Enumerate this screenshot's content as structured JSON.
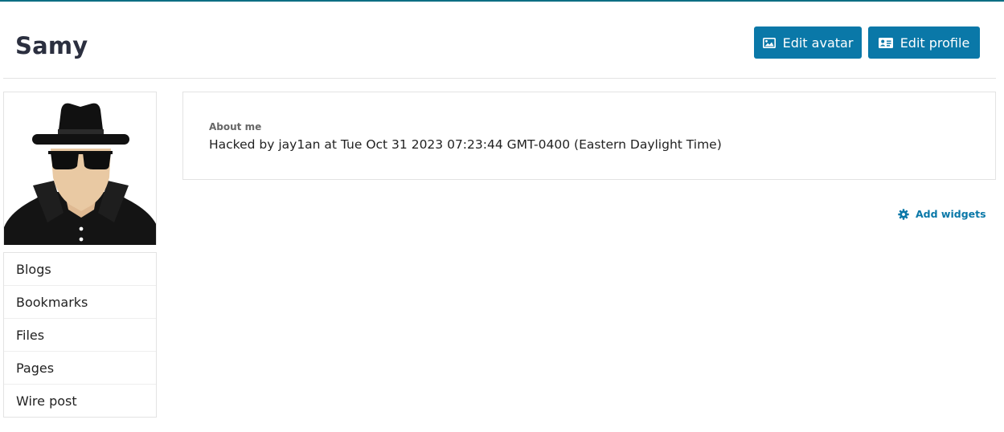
{
  "profile": {
    "name": "Samy",
    "avatar_alt": "spy-avatar-icon"
  },
  "actions": {
    "edit_avatar_label": "Edit avatar",
    "edit_avatar_icon": "image-icon",
    "edit_profile_label": "Edit profile",
    "edit_profile_icon": "id-card-icon"
  },
  "owner_menu": {
    "items": [
      {
        "label": "Blogs"
      },
      {
        "label": "Bookmarks"
      },
      {
        "label": "Files"
      },
      {
        "label": "Pages"
      },
      {
        "label": "Wire post"
      }
    ]
  },
  "about": {
    "label": "About me",
    "text": "Hacked by jay1an at Tue Oct 31 2023 07:23:44 GMT-0400 (Eastern Daylight Time)"
  },
  "widgets": {
    "add_label": "Add widgets",
    "add_icon": "gear-icon"
  },
  "colors": {
    "accent": "#0a78a8",
    "title": "#2b2f3f",
    "border": "#e3e3e3"
  }
}
